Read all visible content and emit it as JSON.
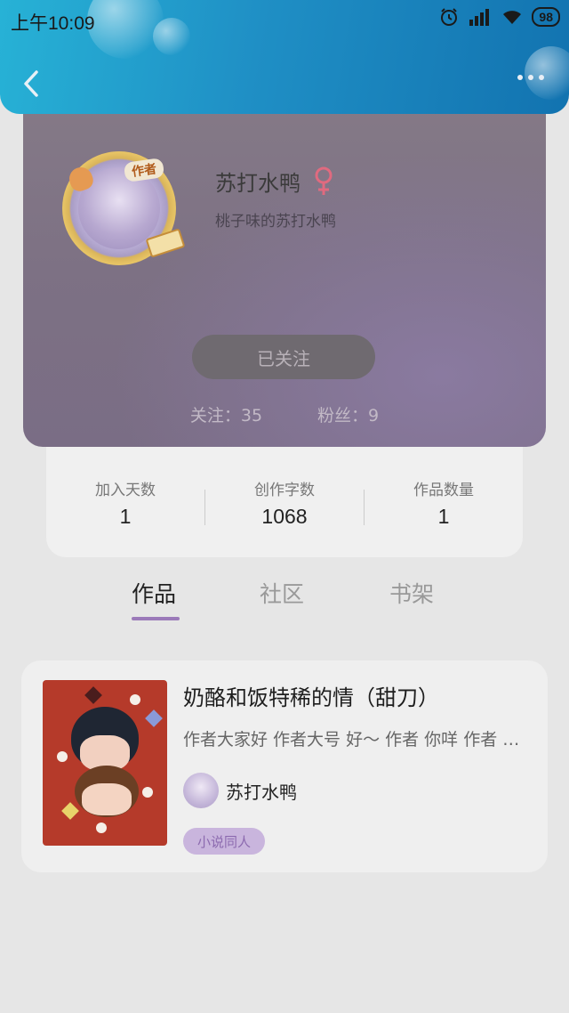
{
  "status_bar": {
    "time": "上午10:09",
    "battery": "98"
  },
  "header": {
    "back_icon": "chevron-left-icon",
    "more_icon": "more-horizontal-icon"
  },
  "profile": {
    "author_badge": "作者",
    "username": "苏打水鸭",
    "gender_icon": "female-icon",
    "signature": "桃子味的苏打水鸭",
    "follow_button": "已关注",
    "following": "关注：35",
    "fans": "粉丝：9"
  },
  "stats": [
    {
      "label": "加入天数",
      "value": "1"
    },
    {
      "label": "创作字数",
      "value": "1068"
    },
    {
      "label": "作品数量",
      "value": "1"
    }
  ],
  "tabs": [
    {
      "label": "作品",
      "active": true
    },
    {
      "label": "社区",
      "active": false
    },
    {
      "label": "书架",
      "active": false
    }
  ],
  "works": [
    {
      "title": "奶酪和饭特稀的情（甜刀）",
      "description": "作者大家好 作者大号 好～ 作者 你咩 作者 你咩",
      "author": "苏打水鸭",
      "tag": "小说同人"
    }
  ],
  "colors": {
    "header_gradient_start": "#27b2d6",
    "header_gradient_end": "#1273b0",
    "accent_purple": "#9b7ab9",
    "female_pink": "#e06a7f"
  }
}
